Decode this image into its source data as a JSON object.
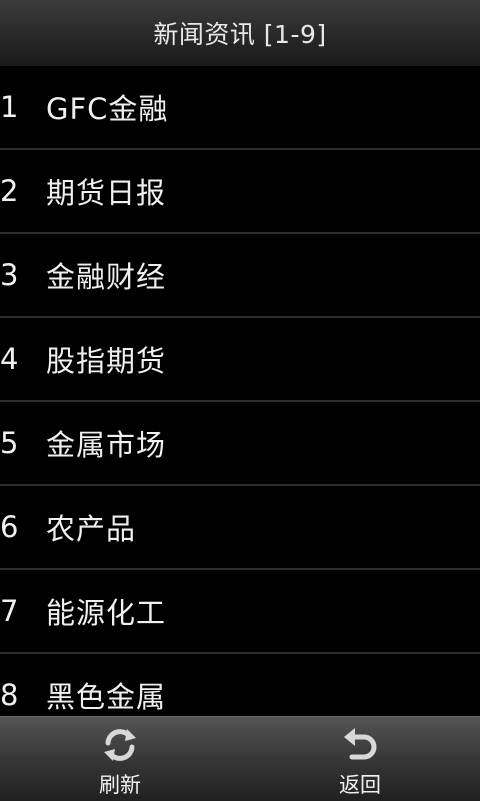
{
  "header": {
    "title": "新闻资讯 [1-9]"
  },
  "list": [
    {
      "num": "1",
      "label": "GFC金融"
    },
    {
      "num": "2",
      "label": "期货日报"
    },
    {
      "num": "3",
      "label": "金融财经"
    },
    {
      "num": "4",
      "label": "股指期货"
    },
    {
      "num": "5",
      "label": "金属市场"
    },
    {
      "num": "6",
      "label": "农产品"
    },
    {
      "num": "7",
      "label": "能源化工"
    },
    {
      "num": "8",
      "label": "黑色金属"
    }
  ],
  "toolbar": {
    "refresh_label": "刷新",
    "refresh_icon": "refresh-icon",
    "back_label": "返回",
    "back_icon": "back-icon"
  }
}
